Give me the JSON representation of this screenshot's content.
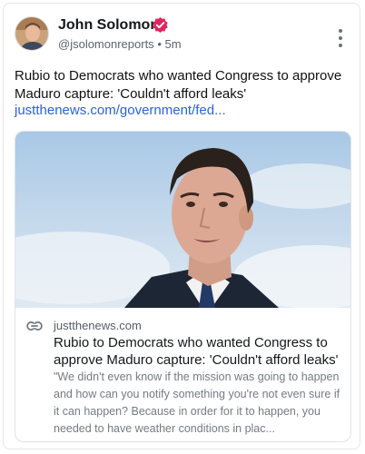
{
  "author": {
    "name": "John Solomon",
    "handle": "@jsolomonreports",
    "separator": "•",
    "time": "5m"
  },
  "post": {
    "text": "Rubio to Democrats who wanted Congress to approve Maduro capture: 'Couldn't afford leaks'",
    "link_text": "justthenews.com/government/fed..."
  },
  "card": {
    "domain": "justthenews.com",
    "title": "Rubio to Democrats who wanted Congress to approve Maduro capture: 'Couldn't afford leaks'",
    "description": "\"We didn't even know if the mission was going to happen and how can you notify something you're not even sure if it can happen? Because in order for it to happen, you needed to have weather conditions in plac..."
  },
  "colors": {
    "verified_badge": "#e0245e",
    "link": "#2c61d6",
    "sky": "#c8dcef"
  },
  "icons": {
    "verified": "verified-badge-icon",
    "more": "more-vertical-icon",
    "link": "link-icon"
  }
}
